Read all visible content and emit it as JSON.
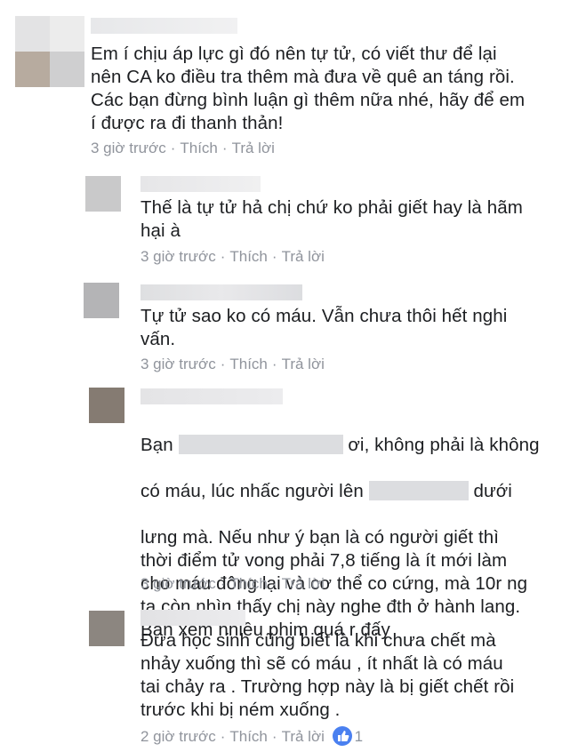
{
  "comments": [
    {
      "text": "Em í chịu áp lực gì đó nên tự tử, có viết thư để lại\nnên CA ko điều tra thêm mà đưa về quê an táng rồi.\nCác bạn đừng bình luận gì thêm nữa nhé, hãy để em\ní được ra đi thanh thản!",
      "time": "3 giờ trước",
      "like": "Thích",
      "reply": "Trả lời"
    },
    {
      "text": "Thế là tự tử hả chị chứ ko phải giết hay là hãm\nhại à",
      "time": "3 giờ trước",
      "like": "Thích",
      "reply": "Trả lời"
    },
    {
      "text": "Tự tử sao ko có máu. Vẫn chưa thôi hết nghi\nvấn.",
      "time": "3 giờ trước",
      "like": "Thích",
      "reply": "Trả lời"
    },
    {
      "line1_a": "Bạn",
      "line1_b": "ơi, không phải là không",
      "line2_a": "có máu, lúc nhấc người lên",
      "line2_b": "dưới",
      "rest": "lưng mà. Nếu như ý bạn là có người giết thì\nthời điểm tử vong phải 7,8 tiếng là ít mới làm\ncho máu đông lại và cơ thể co cứng, mà 10r ng\nta còn nhìn thấy chị này nghe đth ở hành lang.\nBạn xem nhiều phim quá r đấy",
      "time": "3 giờ trước",
      "like": "Thích",
      "reply": "Trả lời"
    },
    {
      "text": "Đứa học sinh cũng biết là khi chưa chết mà\nnhảy xuống thì sẽ có máu , ít nhất là có máu\ntai chảy ra . Trường hợp này là bị giết chết rồi\ntrước khi bị ném xuống .",
      "time": "2 giờ trước",
      "like": "Thích",
      "reply": "Trả lời",
      "like_count": "1"
    }
  ],
  "meta_separator": "·",
  "colors": {
    "meta": "#90949c",
    "text": "#1c1e21",
    "like_badge": "#4a80f0"
  }
}
